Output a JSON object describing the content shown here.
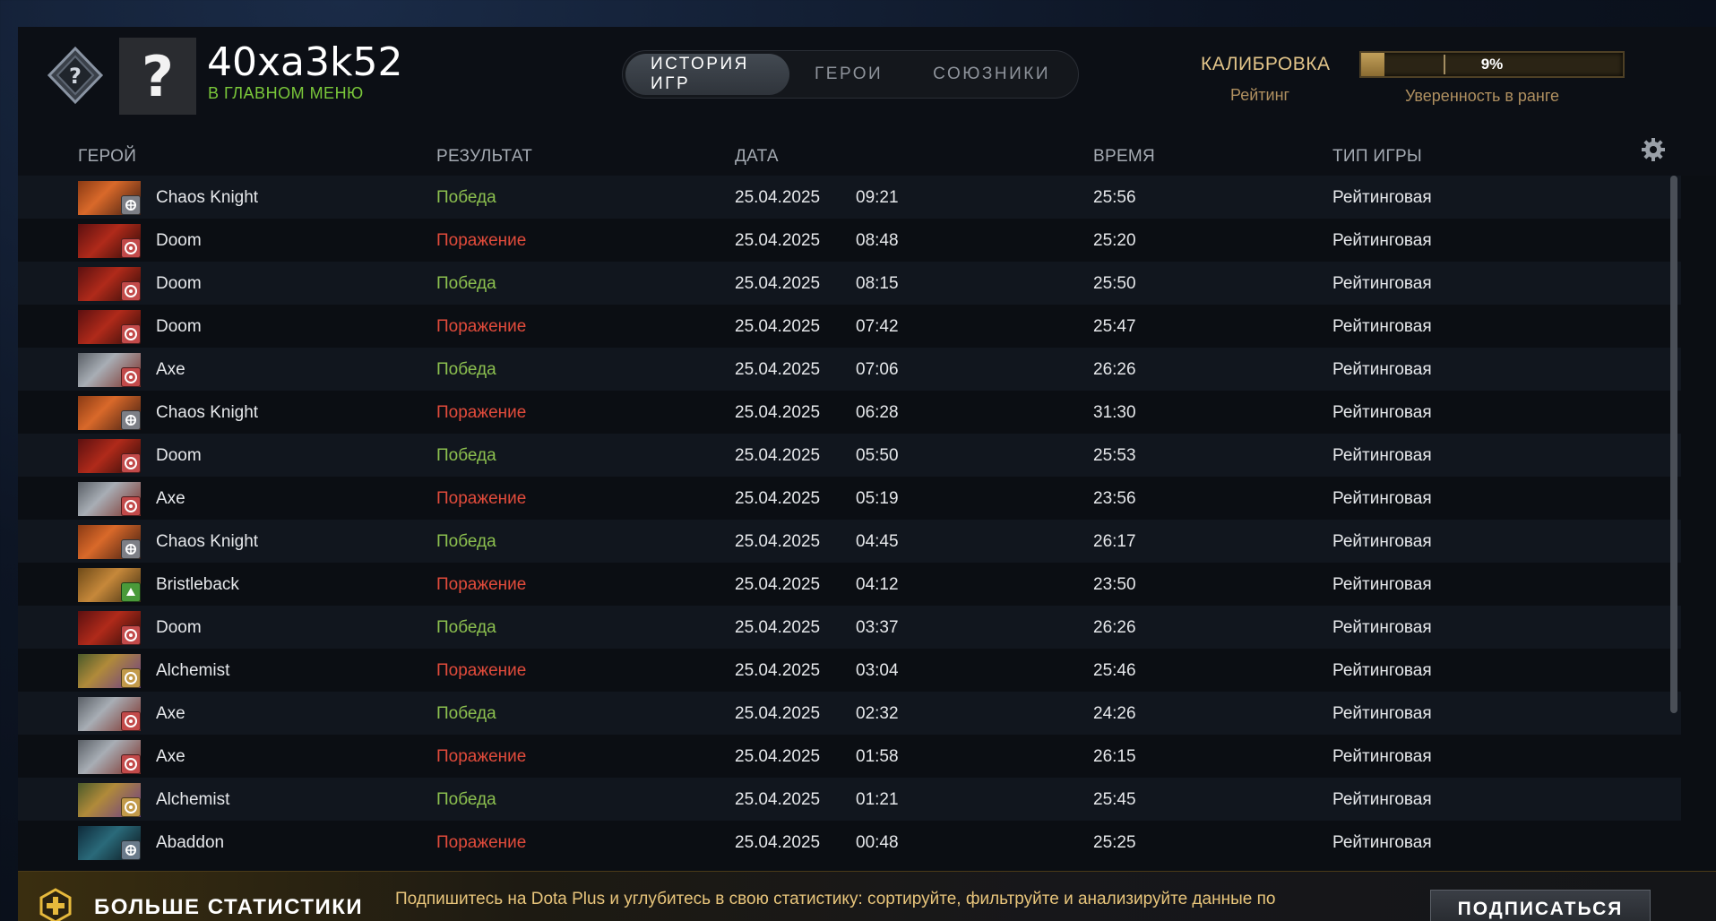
{
  "player": {
    "name": "40xa3k52",
    "status": "В ГЛАВНОМ МЕНЮ",
    "avatar_glyph": "?"
  },
  "tabs": [
    {
      "label": "ИСТОРИЯ ИГР",
      "active": true
    },
    {
      "label": "ГЕРОИ",
      "active": false
    },
    {
      "label": "СОЮЗНИКИ",
      "active": false
    }
  ],
  "calibration": {
    "title": "КАЛИБРОВКА",
    "subtitle": "Рейтинг",
    "progress_label": "9%",
    "progress_fraction": 0.09,
    "bar_caption": "Уверенность в ранге"
  },
  "columns": {
    "hero": "ГЕРОЙ",
    "result": "РЕЗУЛЬТАТ",
    "date": "ДАТА",
    "duration": "ВРЕМЯ",
    "mode": "ТИП ИГРЫ"
  },
  "colors": {
    "win": "#8cc04f",
    "loss": "#e14b3b",
    "accent_gold": "#e3c58a"
  },
  "matches": [
    {
      "hero": "Chaos Knight",
      "result": "Победа",
      "win": true,
      "date": "25.04.2025",
      "time": "09:21",
      "duration": "25:56",
      "mode": "Рейтинговая"
    },
    {
      "hero": "Doom",
      "result": "Поражение",
      "win": false,
      "date": "25.04.2025",
      "time": "08:48",
      "duration": "25:20",
      "mode": "Рейтинговая"
    },
    {
      "hero": "Doom",
      "result": "Победа",
      "win": true,
      "date": "25.04.2025",
      "time": "08:15",
      "duration": "25:50",
      "mode": "Рейтинговая"
    },
    {
      "hero": "Doom",
      "result": "Поражение",
      "win": false,
      "date": "25.04.2025",
      "time": "07:42",
      "duration": "25:47",
      "mode": "Рейтинговая"
    },
    {
      "hero": "Axe",
      "result": "Победа",
      "win": true,
      "date": "25.04.2025",
      "time": "07:06",
      "duration": "26:26",
      "mode": "Рейтинговая"
    },
    {
      "hero": "Chaos Knight",
      "result": "Поражение",
      "win": false,
      "date": "25.04.2025",
      "time": "06:28",
      "duration": "31:30",
      "mode": "Рейтинговая"
    },
    {
      "hero": "Doom",
      "result": "Победа",
      "win": true,
      "date": "25.04.2025",
      "time": "05:50",
      "duration": "25:53",
      "mode": "Рейтинговая"
    },
    {
      "hero": "Axe",
      "result": "Поражение",
      "win": false,
      "date": "25.04.2025",
      "time": "05:19",
      "duration": "23:56",
      "mode": "Рейтинговая"
    },
    {
      "hero": "Chaos Knight",
      "result": "Победа",
      "win": true,
      "date": "25.04.2025",
      "time": "04:45",
      "duration": "26:17",
      "mode": "Рейтинговая"
    },
    {
      "hero": "Bristleback",
      "result": "Поражение",
      "win": false,
      "date": "25.04.2025",
      "time": "04:12",
      "duration": "23:50",
      "mode": "Рейтинговая"
    },
    {
      "hero": "Doom",
      "result": "Победа",
      "win": true,
      "date": "25.04.2025",
      "time": "03:37",
      "duration": "26:26",
      "mode": "Рейтинговая"
    },
    {
      "hero": "Alchemist",
      "result": "Поражение",
      "win": false,
      "date": "25.04.2025",
      "time": "03:04",
      "duration": "25:46",
      "mode": "Рейтинговая"
    },
    {
      "hero": "Axe",
      "result": "Победа",
      "win": true,
      "date": "25.04.2025",
      "time": "02:32",
      "duration": "24:26",
      "mode": "Рейтинговая"
    },
    {
      "hero": "Axe",
      "result": "Поражение",
      "win": false,
      "date": "25.04.2025",
      "time": "01:58",
      "duration": "26:15",
      "mode": "Рейтинговая"
    },
    {
      "hero": "Alchemist",
      "result": "Победа",
      "win": true,
      "date": "25.04.2025",
      "time": "01:21",
      "duration": "25:45",
      "mode": "Рейтинговая"
    },
    {
      "hero": "Abaddon",
      "result": "Поражение",
      "win": false,
      "date": "25.04.2025",
      "time": "00:48",
      "duration": "25:25",
      "mode": "Рейтинговая"
    }
  ],
  "banner": {
    "title": "БОЛЬШЕ СТАТИСТИКИ",
    "text": "Подпишитесь на Dota Plus и углубитесь в свою статистику: сортируйте, фильтруйте и анализируйте данные по",
    "button": "ПОДПИСАТЬСЯ"
  }
}
